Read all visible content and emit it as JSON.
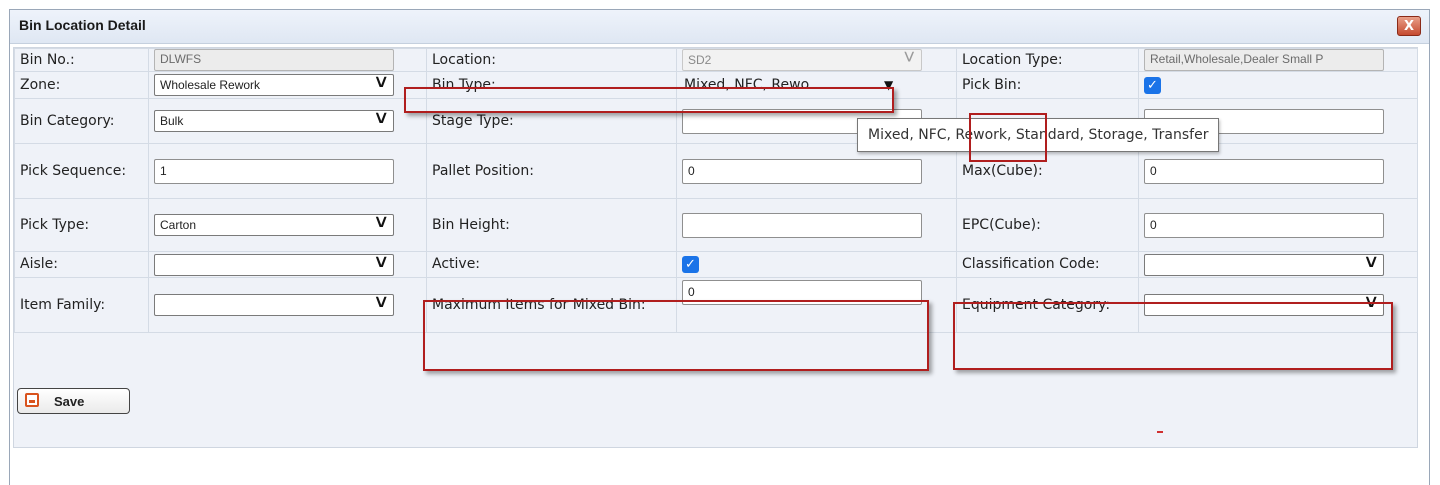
{
  "dialog": {
    "title": "Bin Location Detail",
    "close_glyph": "X"
  },
  "rows": {
    "r1": {
      "bin_no_label": "Bin No.:",
      "bin_no_value": "DLWFS",
      "location_label": "Location:",
      "location_value": "SD2",
      "location_type_label": "Location Type:",
      "location_type_value": "Retail,Wholesale,Dealer Small P"
    },
    "r2": {
      "zone_label": "Zone:",
      "zone_value": "Wholesale Rework",
      "bin_type_label": "Bin Type:",
      "bin_type_value": "Mixed, NFC, Rewo...",
      "pick_bin_label": "Pick Bin:",
      "pick_bin_checked": true
    },
    "r3": {
      "bin_category_label": "Bin Category:",
      "bin_category_value": "Bulk",
      "stage_type_label": "Stage Type:",
      "stage_type_value": ""
    },
    "r4": {
      "pick_sequence_label": "Pick Sequence:",
      "pick_sequence_value": "1",
      "pallet_position_label": "Pallet Position:",
      "pallet_position_value": "0",
      "max_cube_label": "Max(Cube):",
      "max_cube_value": "0"
    },
    "r5": {
      "pick_type_label": "Pick Type:",
      "pick_type_value": "Carton",
      "bin_height_label": "Bin Height:",
      "bin_height_value": "",
      "epc_cube_label": "EPC(Cube):",
      "epc_cube_value": "0"
    },
    "r6": {
      "aisle_label": "Aisle:",
      "aisle_value": "",
      "active_label": "Active:",
      "active_checked": true,
      "classification_code_label": "Classification Code:",
      "classification_code_value": ""
    },
    "r7": {
      "item_family_label": "Item Family:",
      "item_family_value": "",
      "max_items_label": "Maximum Items for Mixed Bin:",
      "max_items_value": "0",
      "equipment_category_label": "Equipment Category:",
      "equipment_category_value": ""
    }
  },
  "tooltip": {
    "text": "Mixed, NFC, Rework, Standard, Storage, Transfer"
  },
  "actions": {
    "save_label": "Save"
  },
  "icons": {
    "chevron": "chevron-down-icon",
    "check": "checkmark-icon",
    "save": "floppy-disk-icon",
    "close": "close-icon"
  },
  "colors": {
    "highlight": "#b01e1e",
    "checkbox": "#1a73e8",
    "panel": "#eff2f8"
  }
}
